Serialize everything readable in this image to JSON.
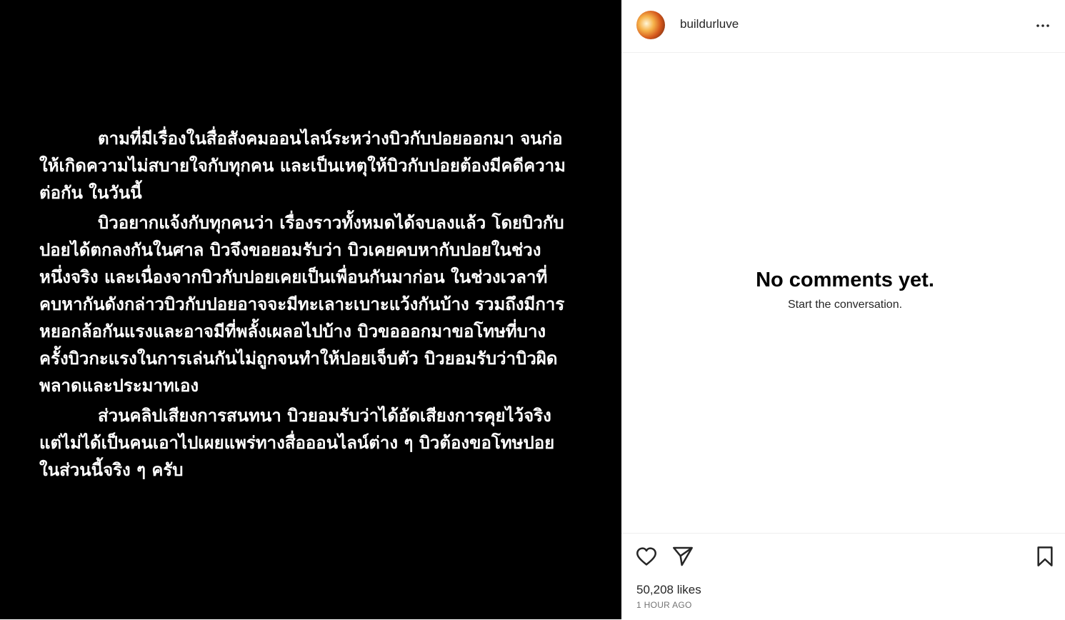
{
  "post": {
    "paragraphs": [
      "ตามที่มีเรื่องในสื่อสังคมออนไลน์ระหว่างบิวกับปอยออกมา จนก่อ\nให้เกิดความไม่สบายใจกับทุกคน และเป็นเหตุให้บิวกับปอยต้องมีคดีความ\nต่อกัน ในวันนี้",
      "บิวอยากแจ้งกับทุกคนว่า เรื่องราวทั้งหมดได้จบลงแล้ว โดยบิวกับ\nปอยได้ตกลงกันในศาล บิวจึงขอยอมรับว่า บิวเคยคบหากับปอยในช่วง\nหนึ่งจริง และเนื่องจากบิวกับปอยเคยเป็นเพื่อนกันมาก่อน ในช่วงเวลาที่\nคบหากันดังกล่าวบิวกับปอยอาจจะมีทะเลาะเบาะแว้งกันบ้าง รวมถึงมีการ\nหยอกล้อกันแรงและอาจมีที่พลั้งเผลอไปบ้าง บิวขอออกมาขอโทษที่บาง\nครั้งบิวกะแรงในการเล่นกันไม่ถูกจนทำให้ปอยเจ็บตัว บิวยอมรับว่าบิวผิด\nพลาดและประมาทเอง",
      "ส่วนคลิปเสียงการสนทนา บิวยอมรับว่าได้อัดเสียงการคุยไว้จริง\nแต่ไม่ได้เป็นคนเอาไปเผยแพร่ทางสื่อออนไลน์ต่าง ๆ บิวต้องขอโทษปอย\nในส่วนนี้จริง ๆ ครับ"
    ]
  },
  "header": {
    "username": "buildurluve",
    "more_icon": "more-horizontal-icon"
  },
  "comments": {
    "empty_title": "No comments yet.",
    "empty_subtitle": "Start the conversation."
  },
  "actions": {
    "icons": [
      "heart-icon",
      "send-icon",
      "bookmark-icon"
    ],
    "likes": "50,208 likes",
    "timestamp": "1 HOUR AGO"
  },
  "colors": {
    "media_background": "#000000",
    "panel_background": "#ffffff",
    "divider": "#efefef",
    "secondary_text": "#737373"
  }
}
